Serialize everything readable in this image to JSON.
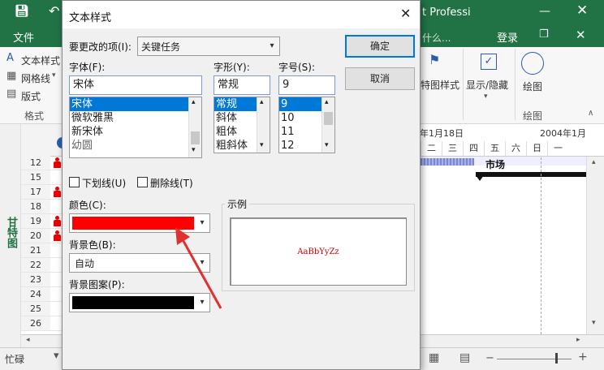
{
  "app": {
    "title_fragment": "t Professi",
    "login": "登录",
    "file_tab": "文件",
    "tell_me": "什么..."
  },
  "ribbon": {
    "left_items": [
      "文本样式",
      "网格线",
      "版式"
    ],
    "left_group": "格式",
    "gantt_style": "特图样式",
    "show_hide": "显示/隐藏",
    "drawing": "绘图",
    "drawing_group": "绘图"
  },
  "sidebar_label": "甘特图",
  "grid": {
    "rows": [
      "12",
      "15",
      "17",
      "18",
      "19",
      "20",
      "21",
      "22",
      "23",
      "24",
      "25",
      "26"
    ],
    "person_rows": [
      "12",
      "17",
      "19",
      "20"
    ]
  },
  "gantt": {
    "date1": "年1月18日",
    "date2": "2004年1月",
    "days": [
      "二",
      "三",
      "四",
      "五",
      "六",
      "日",
      "一"
    ],
    "task_label": "市场"
  },
  "status": {
    "left": "忙碌"
  },
  "dialog": {
    "title": "文本样式",
    "item_label": "要更改的项(I):",
    "item_value": "关键任务",
    "ok": "确定",
    "cancel": "取消",
    "font_label": "字体(F):",
    "font_value": "宋体",
    "font_list": [
      "宋体",
      "微软雅黑",
      "新宋体",
      "幼圆"
    ],
    "style_label": "字形(Y):",
    "style_value": "常规",
    "style_list": [
      "常规",
      "斜体",
      "粗体",
      "粗斜体"
    ],
    "size_label": "字号(S):",
    "size_value": "9",
    "size_list": [
      "9",
      "10",
      "11",
      "12"
    ],
    "underline": "下划线(U)",
    "strikethrough": "删除线(T)",
    "color_label": "颜色(C):",
    "color_value": "#ff0000",
    "bgcolor_label": "背景色(B):",
    "bgcolor_value": "自动",
    "pattern_label": "背景图案(P):",
    "pattern_value": "#000000",
    "sample_label": "示例",
    "sample_text": "AaBbYyZz",
    "sample_color": "#cc0000"
  },
  "colors": {
    "brand": "#217346",
    "accent": "#0078d7",
    "arrow": "#e03030"
  }
}
